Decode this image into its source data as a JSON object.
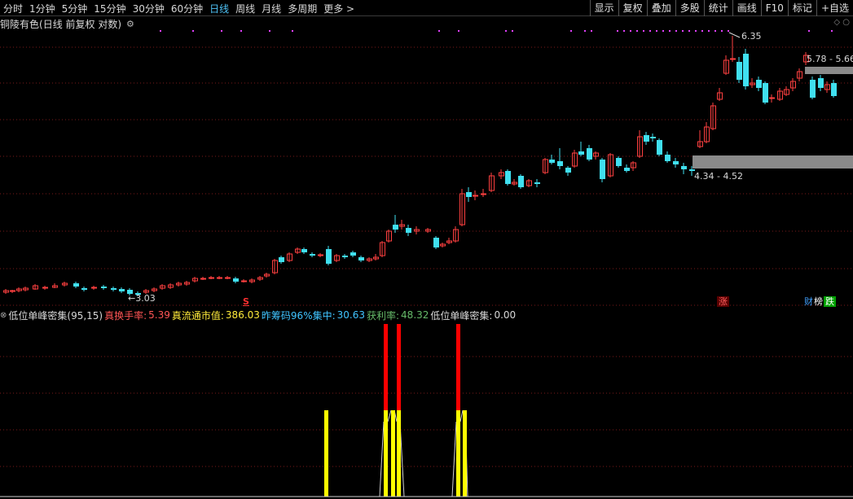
{
  "toolbar": {
    "periods": [
      "分时",
      "1分钟",
      "5分钟",
      "15分钟",
      "30分钟",
      "60分钟",
      "日线",
      "周线",
      "月线",
      "多周期",
      "更多 >"
    ],
    "active_period": "日线",
    "actions": [
      "显示",
      "复权",
      "叠加",
      "多股",
      "统计",
      "画线",
      "F10",
      "标记",
      "+自选"
    ]
  },
  "title": {
    "stock_name": "铜陵有色",
    "chart_desc": "(日线 前复权 对数)"
  },
  "main_chart": {
    "price_labels": {
      "high": "6.35",
      "right_range": "5.78 - 5.66",
      "mid_range": "4.34 - 4.52",
      "low": "3.03"
    },
    "marker_s": "S",
    "badge_up": "涨",
    "badge_cai": "财",
    "badge_bang": "榜",
    "badge_die": "跌",
    "colors": {
      "up": "#ff4040",
      "down": "#40e0f0",
      "grid": "#7a1a1a",
      "zone": "#808080",
      "dots": "#e040fb"
    }
  },
  "indicator": {
    "name": "低位单峰密集(95,15)",
    "turnover_label": "真换手率:",
    "turnover_value": "5.39",
    "float_cap_label": "真流通市值:",
    "float_cap_value": "386.03",
    "chip_label": "昨筹码96%集中:",
    "chip_value": "30.63",
    "profit_label": "获利率:",
    "profit_value": "48.32",
    "peak_label": "低位单峰密集:",
    "peak_value": "0.00"
  }
}
